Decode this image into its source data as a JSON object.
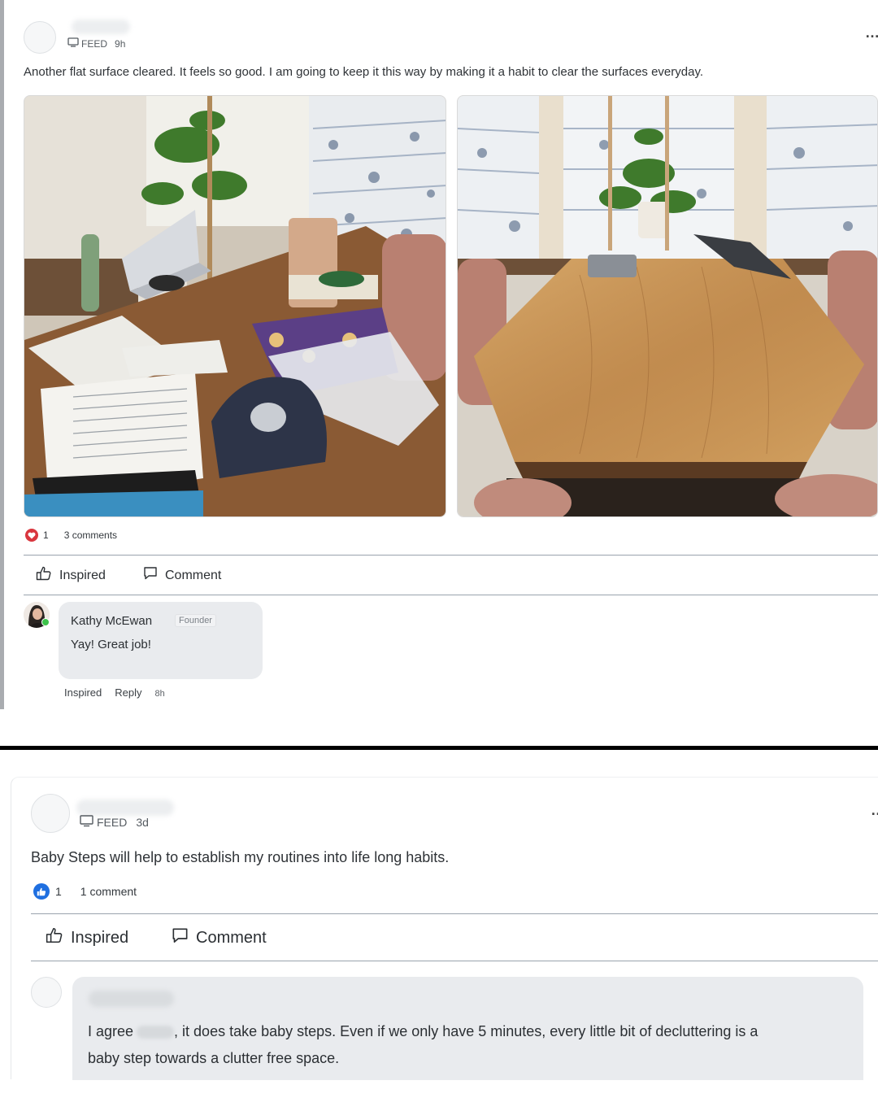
{
  "post1": {
    "feed_label": "FEED",
    "age": "9h",
    "more_label": "…",
    "text": "Another flat surface cleared. It feels so good. I am going to keep it this way by making it a habit to clear the surfaces everyday.",
    "reaction_count": "1",
    "comments_count": "3 comments",
    "actions": {
      "inspired": "Inspired",
      "comment": "Comment"
    },
    "comment": {
      "author": "Kathy McEwan",
      "badge": "Founder",
      "text": "Yay! Great job!",
      "inspired": "Inspired",
      "reply": "Reply",
      "age": "8h"
    }
  },
  "post2": {
    "feed_label": "FEED",
    "age": "3d",
    "more_label": "…",
    "text": "Baby Steps will help to establish my routines into life long habits.",
    "reaction_count": "1",
    "comments_count": "1 comment",
    "actions": {
      "inspired": "Inspired",
      "comment": "Comment"
    },
    "comment": {
      "text_before": "I agree",
      "text_after": ", it does take baby steps. Even if we only have 5 minutes, every little bit of decluttering is a",
      "text_line2": "baby step towards a clutter free space."
    }
  },
  "colors": {
    "heart": "#d9363e",
    "like": "#1f6fe0",
    "bubble": "#e9ebee",
    "online": "#3cc24a"
  }
}
